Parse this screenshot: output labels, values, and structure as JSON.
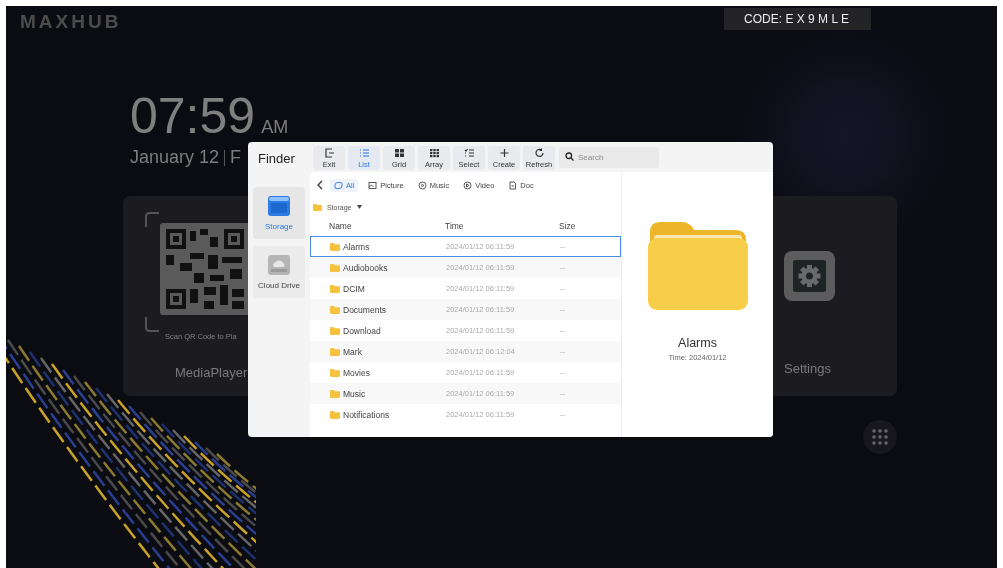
{
  "logo": "MAXHUB",
  "code_badge": "CODE: E X 9 M L E",
  "clock": {
    "time": "07:59",
    "meridiem": "AM",
    "date": "January 12",
    "day": "F"
  },
  "media_player": {
    "qr_caption": "Scan QR Code to Pla",
    "label": "MediaPlayer"
  },
  "settings": {
    "label": "Settings"
  },
  "finder": {
    "title": "Finder",
    "sidebar": [
      {
        "label": "Storage",
        "kind": "storage",
        "selected": true
      },
      {
        "label": "Cloud Drive",
        "kind": "cloud",
        "selected": false
      }
    ],
    "toolbar": [
      {
        "label": "Exit",
        "kind": "exit",
        "selected": false
      },
      {
        "label": "List",
        "kind": "list",
        "selected": true
      },
      {
        "label": "Grid",
        "kind": "grid",
        "selected": false
      },
      {
        "label": "Array",
        "kind": "array",
        "selected": false
      },
      {
        "label": "Select",
        "kind": "select",
        "selected": false
      },
      {
        "label": "Create",
        "kind": "create",
        "selected": false
      },
      {
        "label": "Refresh",
        "kind": "refresh",
        "selected": false
      }
    ],
    "search": {
      "placeholder": "Search"
    },
    "filters": [
      {
        "label": "All",
        "kind": "all",
        "selected": true
      },
      {
        "label": "Picture",
        "kind": "picture",
        "selected": false
      },
      {
        "label": "Music",
        "kind": "music",
        "selected": false
      },
      {
        "label": "Video",
        "kind": "video",
        "selected": false
      },
      {
        "label": "Doc",
        "kind": "doc",
        "selected": false
      }
    ],
    "breadcrumb": "Storage",
    "columns": [
      "Name",
      "Time",
      "Size"
    ],
    "rows": [
      {
        "name": "Alarms",
        "time": "2024/01/12 06:11:59",
        "size": "--",
        "selected": true
      },
      {
        "name": "Audiobooks",
        "time": "2024/01/12 06:11:59",
        "size": "--",
        "selected": false
      },
      {
        "name": "DCIM",
        "time": "2024/01/12 06:11:59",
        "size": "--",
        "selected": false
      },
      {
        "name": "Documents",
        "time": "2024/01/12 06:11:59",
        "size": "--",
        "selected": false
      },
      {
        "name": "Download",
        "time": "2024/01/12 06:11:59",
        "size": "--",
        "selected": false
      },
      {
        "name": "Mark",
        "time": "2024/01/12 06:12:04",
        "size": "--",
        "selected": false
      },
      {
        "name": "Movies",
        "time": "2024/01/12 06:11:59",
        "size": "--",
        "selected": false
      },
      {
        "name": "Music",
        "time": "2024/01/12 06:11:59",
        "size": "--",
        "selected": false
      },
      {
        "name": "Notifications",
        "time": "2024/01/12 06:11:59",
        "size": "--",
        "selected": false
      }
    ],
    "preview": {
      "name": "Alarms",
      "time": "Time: 2024/01/12"
    }
  }
}
